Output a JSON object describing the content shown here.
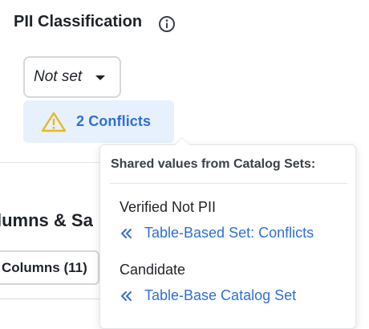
{
  "section": {
    "title": "PII Classification",
    "info_icon": "info-circle-icon"
  },
  "dropdown": {
    "value": "Not set",
    "caret_icon": "caret-down-icon"
  },
  "conflicts": {
    "label": "2 Conflicts",
    "icon": "warning-triangle-icon",
    "icon_color": "#e8b824"
  },
  "background": {
    "heading": "lumns & Sa",
    "columns_tab_label": "Columns (11)"
  },
  "popover": {
    "header": "Shared values from Catalog Sets:",
    "groups": [
      {
        "value": "Verified Not PII",
        "link_text": "Table-Based Set: Conflicts",
        "link_icon": "double-chevron-left-icon"
      },
      {
        "value": "Candidate",
        "link_text": "Table-Base Catalog Set",
        "link_icon": "double-chevron-left-icon"
      }
    ]
  },
  "colors": {
    "link": "#2f6fd6",
    "badge_bg": "#e7f1fd",
    "text": "#1f2328"
  }
}
